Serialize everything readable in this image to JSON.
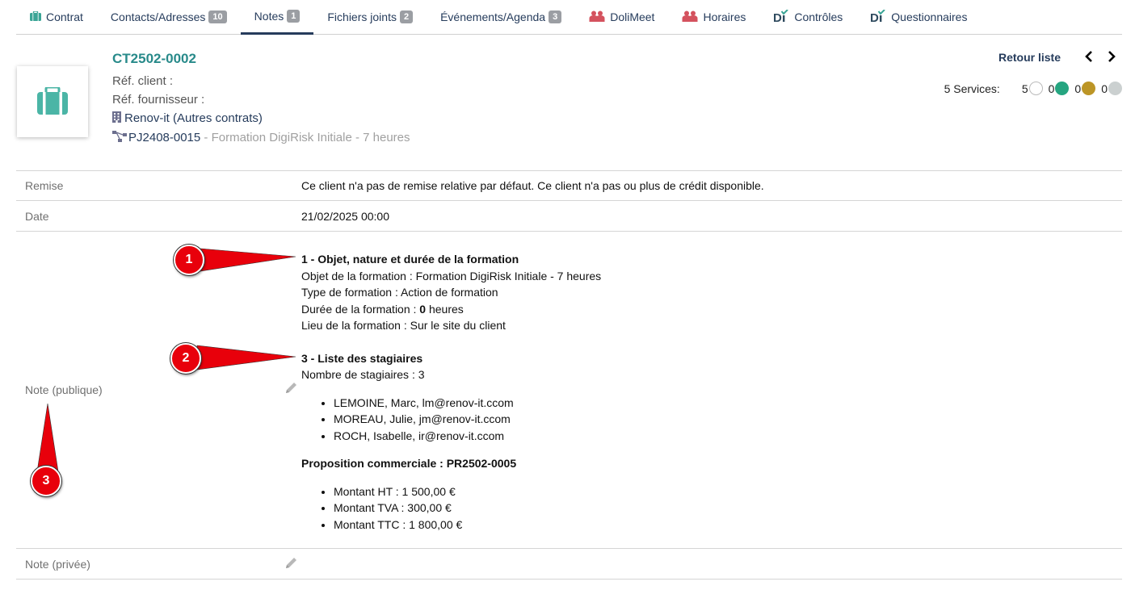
{
  "tabs": [
    {
      "label": "Contrat",
      "badge": "",
      "icon": "briefcase-icon"
    },
    {
      "label": "Contacts/Adresses",
      "badge": "10",
      "icon": ""
    },
    {
      "label": "Notes",
      "badge": "1",
      "icon": "",
      "active": true
    },
    {
      "label": "Fichiers joints",
      "badge": "2",
      "icon": ""
    },
    {
      "label": "Événements/Agenda",
      "badge": "3",
      "icon": ""
    },
    {
      "label": "DoliMeet",
      "badge": "",
      "icon": "users-icon"
    },
    {
      "label": "Horaires",
      "badge": "",
      "icon": "users-icon"
    },
    {
      "label": "Contrôles",
      "badge": "",
      "icon": "di-icon"
    },
    {
      "label": "Questionnaires",
      "badge": "",
      "icon": "di-icon"
    }
  ],
  "header": {
    "ref": "CT2502-0002",
    "ref_client": "Réf. client :",
    "ref_fournisseur": "Réf. fournisseur :",
    "thirdparty": "Renov-it",
    "other_contracts": "(Autres contrats)",
    "project_ref": "PJ2408-0015",
    "project_label": " - Formation DigiRisk Initiale - 7 heures"
  },
  "nav": {
    "back_label": "Retour liste"
  },
  "services": {
    "label": "5 Services:",
    "counts": [
      {
        "value": "5",
        "color": "#ffffff"
      },
      {
        "value": "0",
        "color": "#25a580"
      },
      {
        "value": "0",
        "color": "#bc9526"
      },
      {
        "value": "0",
        "color": "#cbd0d0"
      }
    ]
  },
  "fields": {
    "remise_label": "Remise",
    "remise_value": "Ce client n'a pas de remise relative par défaut. Ce client n'a pas ou plus de crédit disponible.",
    "date_label": "Date",
    "date_value": "21/02/2025 00:00",
    "note_public_label": "Note (publique)",
    "note_private_label": "Note (privée)"
  },
  "note": {
    "section1_title": "1 - Objet, nature et durée de la formation",
    "objet": "Objet de la formation : Formation DigiRisk Initiale - 7 heures",
    "type": "Type de formation : Action de formation",
    "duree_prefix": "Durée de la formation : ",
    "duree_value": "0",
    "duree_suffix": " heures",
    "lieu": "Lieu de la formation : Sur le site du client",
    "section3_title": "3 - Liste des stagiaires",
    "nb_stagiaires": "Nombre de stagiaires : 3",
    "stagiaires": [
      "LEMOINE, Marc, lm@renov-it.ccom",
      "MOREAU, Julie, jm@renov-it.ccom",
      "ROCH, Isabelle, ir@renov-it.ccom"
    ],
    "proposition_title": "Proposition commerciale : PR2502-0005",
    "montants": [
      "Montant HT : 1 500,00 €",
      "Montant TVA : 300,00 €",
      "Montant TTC : 1 800,00 €"
    ]
  },
  "callouts": [
    "1",
    "2",
    "3"
  ]
}
